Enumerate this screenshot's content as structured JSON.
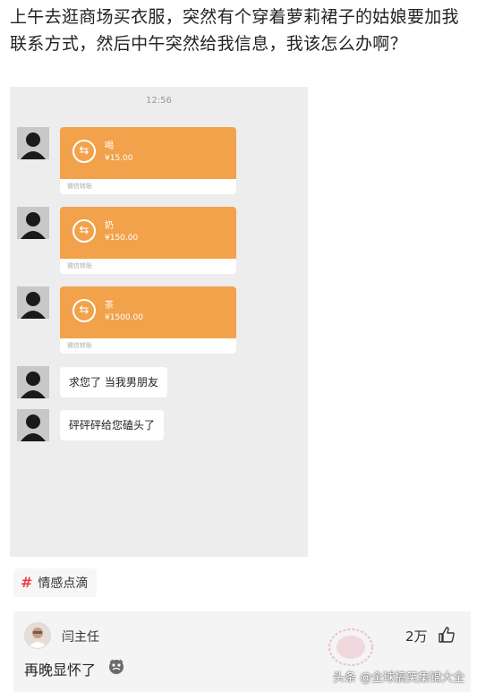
{
  "post": {
    "text": "上午去逛商场买衣服，突然有个穿着萝莉裙子的姑娘要加我联系方式，然后中午突然给我信息，我该怎么办啊？"
  },
  "chat": {
    "time": "12:56",
    "transfers": [
      {
        "item": "喝",
        "amount": "¥15.00",
        "footer": "微信转账"
      },
      {
        "item": "奶",
        "amount": "¥150.00",
        "footer": "微信转账"
      },
      {
        "item": "茶",
        "amount": "¥1500.00",
        "footer": "微信转账"
      }
    ],
    "messages": [
      {
        "text": "求您了 当我男朋友"
      },
      {
        "text": "砰砰砰给您磕头了"
      }
    ],
    "colors": {
      "transfer_orange": "#f1a24a",
      "background": "#ededed"
    }
  },
  "topic": {
    "hash_icon": "hash-icon",
    "label": "情感点滴"
  },
  "comment": {
    "author": "闫主任",
    "likes": "2万",
    "text": "再晚显怀了"
  },
  "watermark": {
    "text": "头条 @全球搞笑集锦大全"
  }
}
